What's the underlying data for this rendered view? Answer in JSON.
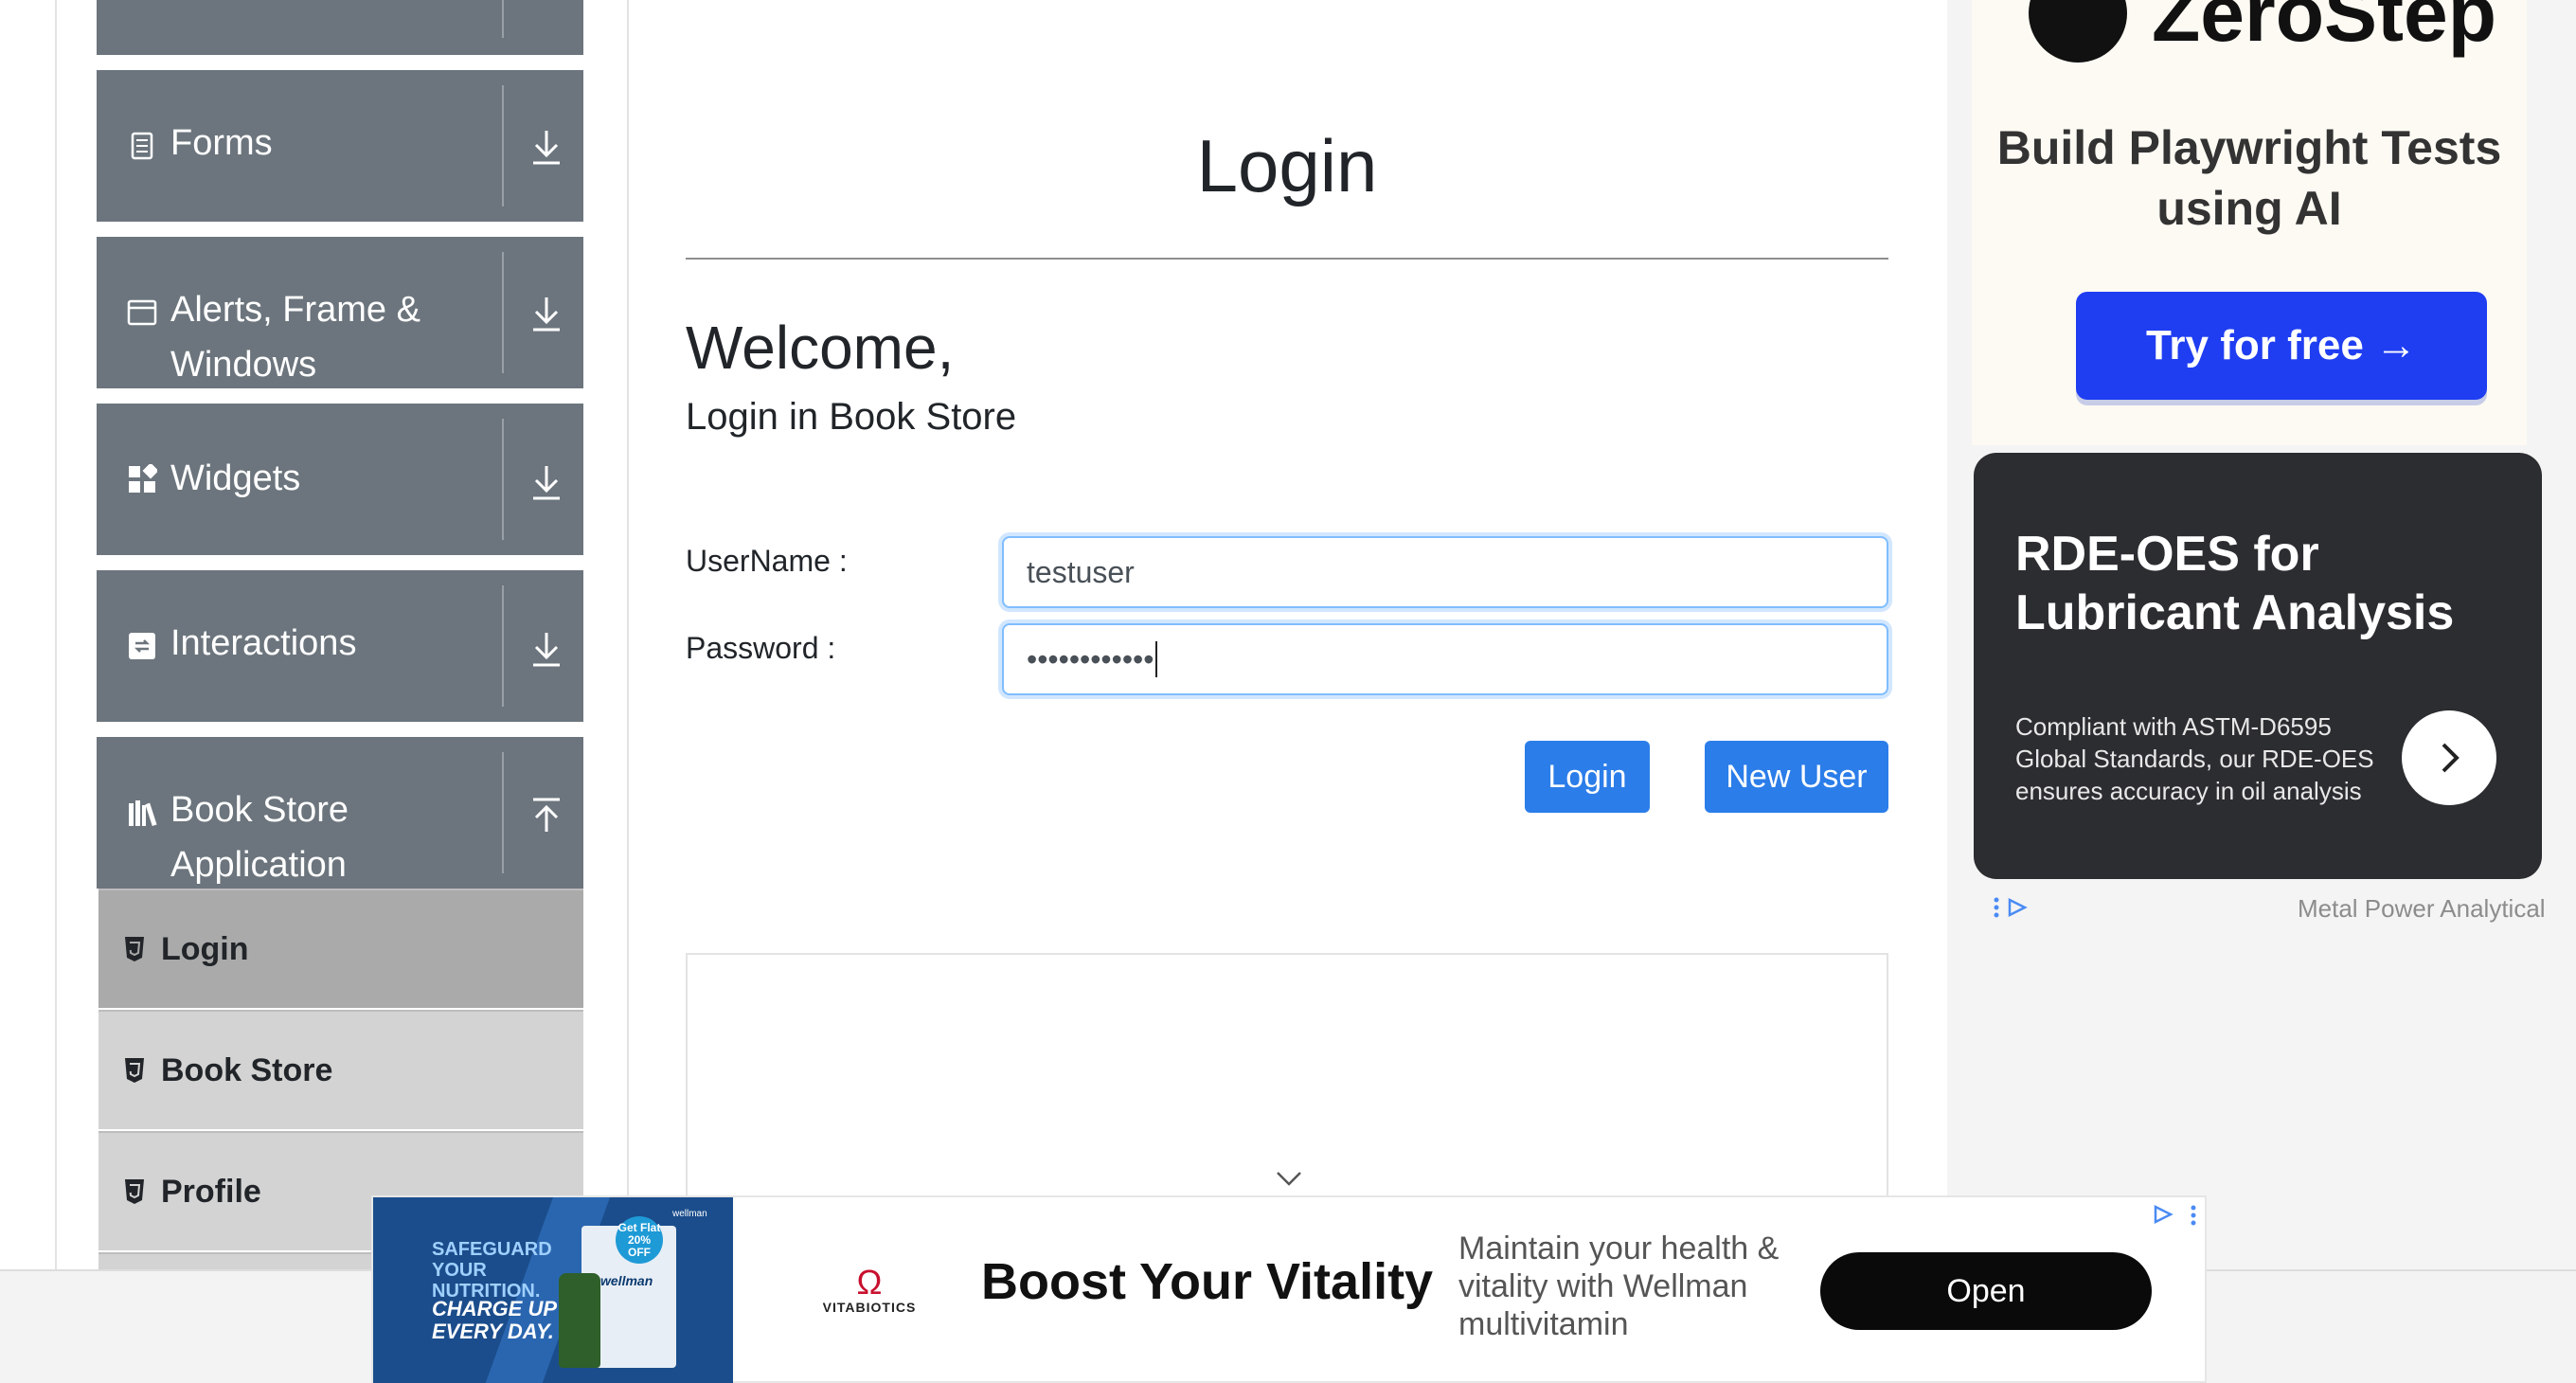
{
  "sidebar": {
    "groups": [
      {
        "label": "",
        "icon": "collapsed-group-icon"
      },
      {
        "label": "Forms",
        "icon": "form-icon"
      },
      {
        "label": "Alerts, Frame & Windows",
        "icon": "window-icon"
      },
      {
        "label": "Widgets",
        "icon": "widgets-icon"
      },
      {
        "label": "Interactions",
        "icon": "interactions-icon"
      },
      {
        "label": "Book Store Application",
        "icon": "library-icon"
      }
    ],
    "subitems": [
      {
        "label": "Login",
        "active": true
      },
      {
        "label": "Book Store",
        "active": false
      },
      {
        "label": "Profile",
        "active": false
      }
    ]
  },
  "main": {
    "title": "Login",
    "welcome": "Welcome,",
    "subtitle": "Login in Book Store",
    "username_label": "UserName :",
    "username_value": "testuser",
    "password_label": "Password :",
    "password_value": "••••••••••••",
    "login_button": "Login",
    "new_user_button": "New User"
  },
  "ads": {
    "zerostep": {
      "brand": "ZeroStep",
      "headline": "Build Playwright Tests using AI",
      "cta": "Try for free →",
      "cta_color": "#1f3ef2"
    },
    "rde": {
      "headline": "RDE-OES for Lubricant Analysis",
      "body": "Compliant with ASTM-D6595 Global Standards, our RDE-OES ensures accuracy in oil analysis",
      "advertiser": "Metal Power Analytical"
    },
    "bottom": {
      "img_line1": "SAFEGUARD YOUR NUTRITION.",
      "img_line2": "CHARGE UP EVERY DAY.",
      "img_badge": "Get Flat 20% OFF",
      "img_brand_small": "wellman",
      "img_corner": "wellman",
      "brand": "VITABIOTICS",
      "brand_symbol": "Ω",
      "headline": "Boost Your Vitality",
      "text": "Maintain your health & vitality with Wellman multivitamin",
      "cta": "Open"
    }
  },
  "colors": {
    "sidebar_group_bg": "#6c757d",
    "sidebar_sub_bg": "#d3d3d3",
    "sidebar_sub_active_bg": "#aaaaaa",
    "primary_button": "#2b7de9"
  }
}
